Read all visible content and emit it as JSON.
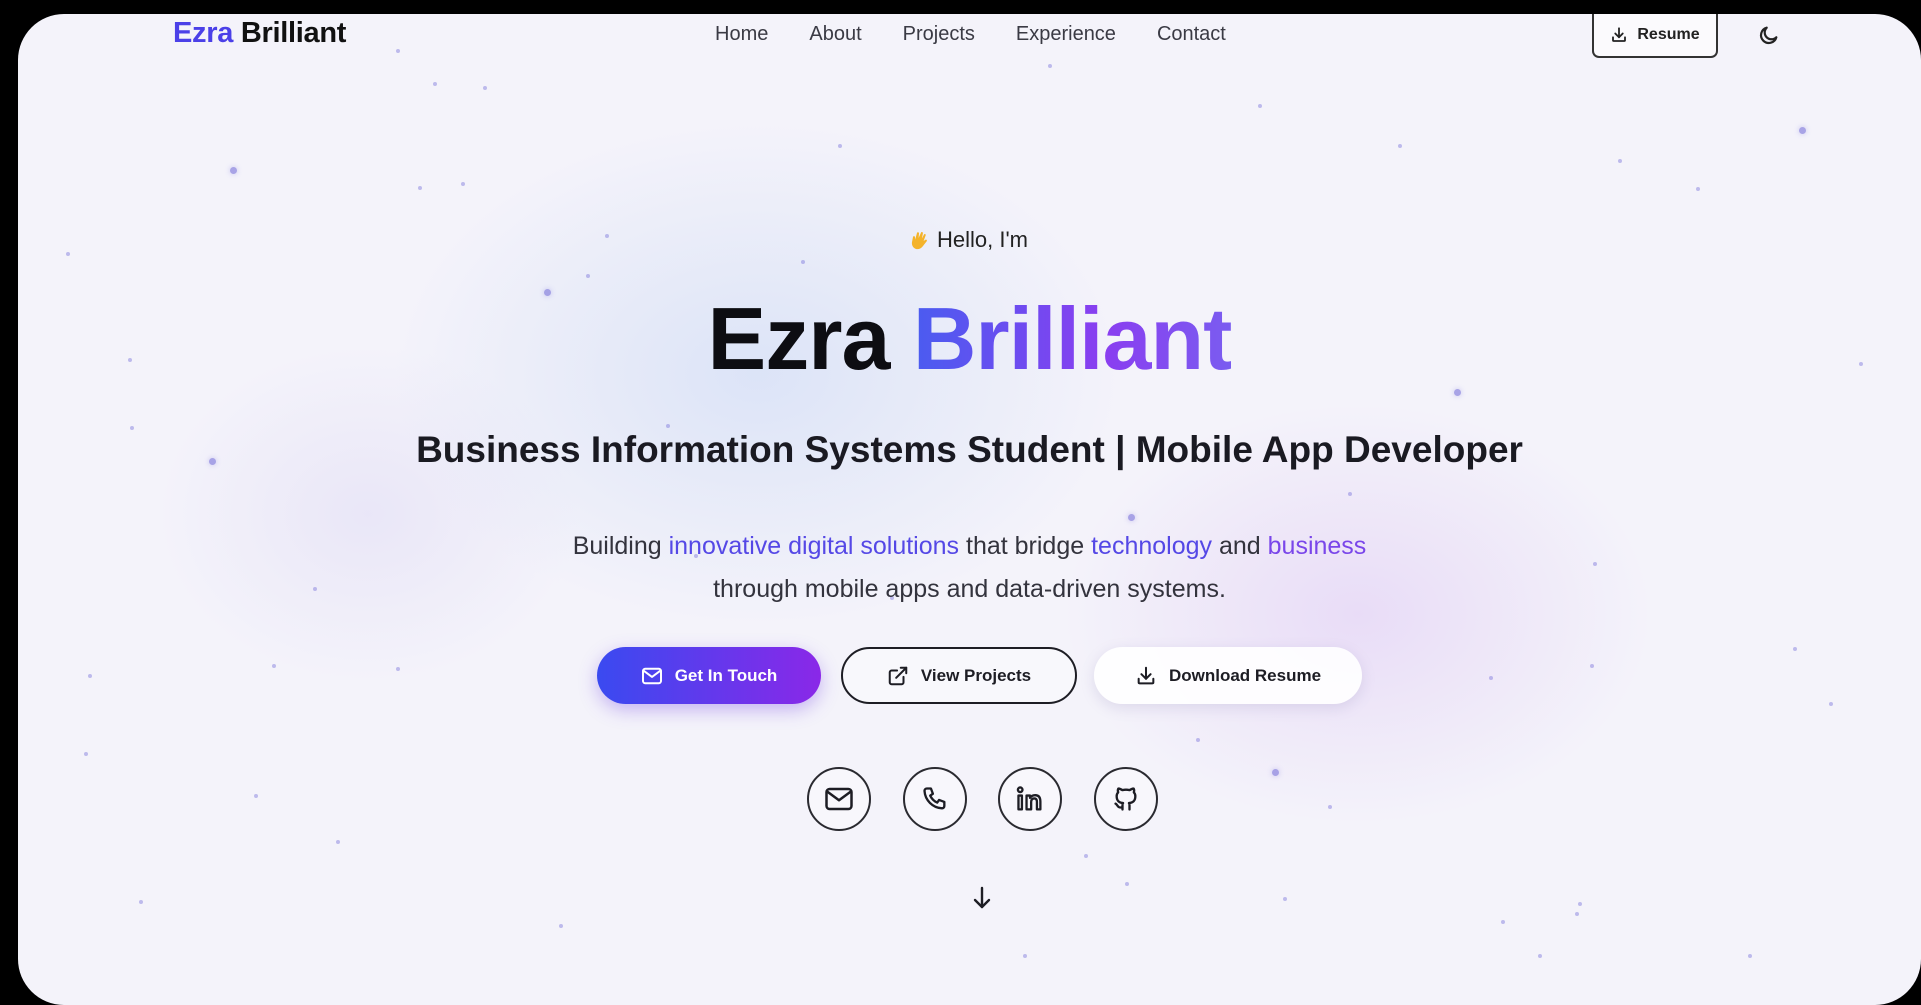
{
  "header": {
    "logo_first": "Ezra",
    "logo_second": "Brilliant",
    "nav": [
      "Home",
      "About",
      "Projects",
      "Experience",
      "Contact"
    ],
    "resume_label": "Resume",
    "theme_icon": "moon-icon"
  },
  "hero": {
    "greeting": "Hello, I'm",
    "greeting_icon": "waving-hand-icon",
    "name_first": "Ezra",
    "name_second": "Brilliant",
    "role": "Business Information Systems Student | Mobile App Developer",
    "desc": {
      "p1": "Building ",
      "h1": "innovative digital solutions",
      "p2": " that bridge ",
      "h2": "technology",
      "p3": " and ",
      "h3": "business",
      "line2": "through mobile apps and data-driven systems."
    },
    "buttons": {
      "contact": "Get In Touch",
      "projects": "View Projects",
      "download": "Download Resume"
    },
    "socials": [
      "mail-icon",
      "phone-icon",
      "linkedin-icon",
      "github-icon"
    ],
    "scroll_icon": "arrow-down-icon"
  },
  "colors": {
    "accent": "#4b40e8",
    "accent_purple": "#8a28e8",
    "background": "#f4f3fa",
    "text": "#0d0d12"
  }
}
